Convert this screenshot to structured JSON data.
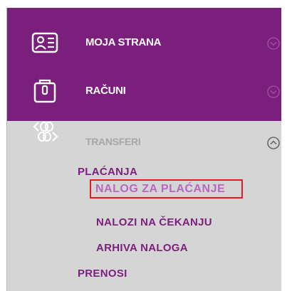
{
  "colors": {
    "purple": "#7b1f7d",
    "submenu_text": "#7b1f7d",
    "selected_text": "#b767bd",
    "highlight_border": "#e8191f",
    "panel_bg": "#d5d5d5",
    "inactive_text": "#a6a6a6"
  },
  "menu": {
    "items": [
      {
        "label": "MOJA STRANA",
        "icon": "contact-card-icon",
        "state": "collapsed"
      },
      {
        "label": "RAČUNI",
        "icon": "wallet-icon",
        "state": "collapsed"
      },
      {
        "label": "TRANSFERI",
        "icon": "transfer-arrows-icon",
        "state": "expanded"
      }
    ],
    "transferi_children": {
      "placanja": {
        "label": "PLAĆANJA",
        "children": [
          {
            "label": "NALOG ZA PLAĆANJE",
            "selected": true
          },
          {
            "label": "NALOZI NA ČEKANJU",
            "selected": false
          },
          {
            "label": "ARHIVA NALOGA",
            "selected": false
          }
        ]
      },
      "prenosi": {
        "label": "PRENOSI"
      }
    }
  }
}
